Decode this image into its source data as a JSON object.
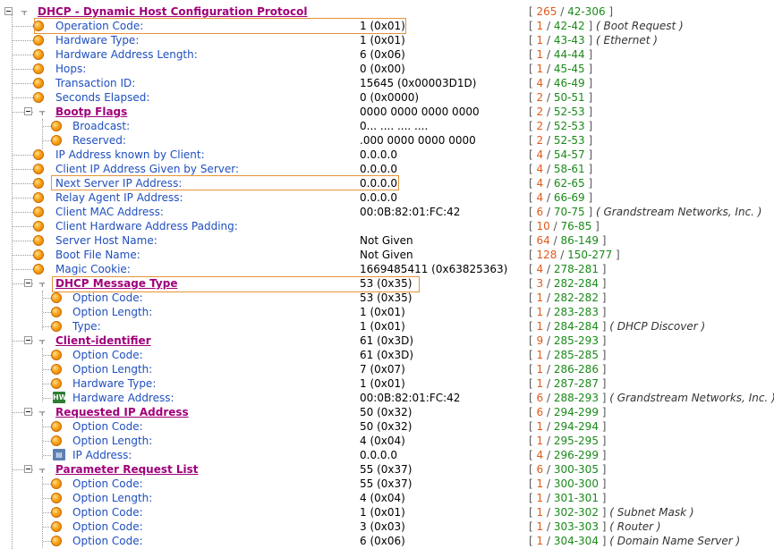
{
  "header": {
    "label": "DHCP - Dynamic Host Configuration Protocol",
    "range_len": "265",
    "range_off": "42-306"
  },
  "rows": [
    {
      "label": "Operation Code:",
      "value": "1 (0x01)",
      "len": "1",
      "off": "42-42",
      "desc": "Boot Request"
    },
    {
      "label": "Hardware Type:",
      "value": "1 (0x01)",
      "len": "1",
      "off": "43-43",
      "desc": "Ethernet"
    },
    {
      "label": "Hardware Address Length:",
      "value": "6 (0x06)",
      "len": "1",
      "off": "44-44",
      "desc": ""
    },
    {
      "label": "Hops:",
      "value": "0 (0x00)",
      "len": "1",
      "off": "45-45",
      "desc": ""
    },
    {
      "label": "Transaction ID:",
      "value": "15645 (0x00003D1D)",
      "len": "4",
      "off": "46-49",
      "desc": ""
    },
    {
      "label": "Seconds Elapsed:",
      "value": "0 (0x0000)",
      "len": "2",
      "off": "50-51",
      "desc": ""
    },
    {
      "label": "Bootp Flags",
      "value": "0000 0000 0000 0000",
      "len": "2",
      "off": "52-53",
      "desc": ""
    },
    {
      "label": "Broadcast:",
      "value": "0... .... .... ....",
      "len": "2",
      "off": "52-53",
      "desc": ""
    },
    {
      "label": "Reserved:",
      "value": ".000 0000 0000 0000",
      "len": "2",
      "off": "52-53",
      "desc": ""
    },
    {
      "label": "IP Address known by Client:",
      "value": "0.0.0.0",
      "len": "4",
      "off": "54-57",
      "desc": ""
    },
    {
      "label": "Client IP Address Given by Server:",
      "value": "0.0.0.0",
      "len": "4",
      "off": "58-61",
      "desc": ""
    },
    {
      "label": "Next Server IP Address:",
      "value": "0.0.0.0",
      "len": "4",
      "off": "62-65",
      "desc": ""
    },
    {
      "label": "Relay Agent IP Address:",
      "value": "0.0.0.0",
      "len": "4",
      "off": "66-69",
      "desc": ""
    },
    {
      "label": "Client MAC Address:",
      "value": "00:0B:82:01:FC:42",
      "len": "6",
      "off": "70-75",
      "desc": "Grandstream Networks, Inc."
    },
    {
      "label": "Client Hardware Address Padding:",
      "value": "",
      "len": "10",
      "off": "76-85",
      "desc": ""
    },
    {
      "label": "Server Host Name:",
      "value": "Not Given",
      "len": "64",
      "off": "86-149",
      "desc": ""
    },
    {
      "label": "Boot File Name:",
      "value": "Not Given",
      "len": "128",
      "off": "150-277",
      "desc": ""
    },
    {
      "label": "Magic Cookie:",
      "value": "1669485411 (0x63825363)",
      "len": "4",
      "off": "278-281",
      "desc": ""
    },
    {
      "label": "DHCP Message Type",
      "value": "53 (0x35)",
      "len": "3",
      "off": "282-284",
      "desc": ""
    },
    {
      "label": "Option Code:",
      "value": "53 (0x35)",
      "len": "1",
      "off": "282-282",
      "desc": ""
    },
    {
      "label": "Option Length:",
      "value": "1 (0x01)",
      "len": "1",
      "off": "283-283",
      "desc": ""
    },
    {
      "label": "Type:",
      "value": "1 (0x01)",
      "len": "1",
      "off": "284-284",
      "desc": "DHCP Discover"
    },
    {
      "label": "Client-identifier",
      "value": "61 (0x3D)",
      "len": "9",
      "off": "285-293",
      "desc": ""
    },
    {
      "label": "Option Code:",
      "value": "61 (0x3D)",
      "len": "1",
      "off": "285-285",
      "desc": ""
    },
    {
      "label": "Option Length:",
      "value": "7 (0x07)",
      "len": "1",
      "off": "286-286",
      "desc": ""
    },
    {
      "label": "Hardware Type:",
      "value": "1 (0x01)",
      "len": "1",
      "off": "287-287",
      "desc": ""
    },
    {
      "label": "Hardware Address:",
      "value": "00:0B:82:01:FC:42",
      "len": "6",
      "off": "288-293",
      "desc": "Grandstream Networks, Inc."
    },
    {
      "label": "Requested IP Address",
      "value": "50 (0x32)",
      "len": "6",
      "off": "294-299",
      "desc": ""
    },
    {
      "label": "Option Code:",
      "value": "50 (0x32)",
      "len": "1",
      "off": "294-294",
      "desc": ""
    },
    {
      "label": "Option Length:",
      "value": "4 (0x04)",
      "len": "1",
      "off": "295-295",
      "desc": ""
    },
    {
      "label": "IP Address:",
      "value": "0.0.0.0",
      "len": "4",
      "off": "296-299",
      "desc": ""
    },
    {
      "label": "Parameter Request List",
      "value": "55 (0x37)",
      "len": "6",
      "off": "300-305",
      "desc": ""
    },
    {
      "label": "Option Code:",
      "value": "55 (0x37)",
      "len": "1",
      "off": "300-300",
      "desc": ""
    },
    {
      "label": "Option Length:",
      "value": "4 (0x04)",
      "len": "1",
      "off": "301-301",
      "desc": ""
    },
    {
      "label": "Option Code:",
      "value": "1 (0x01)",
      "len": "1",
      "off": "302-302",
      "desc": "Subnet Mask"
    },
    {
      "label": "Option Code:",
      "value": "3 (0x03)",
      "len": "1",
      "off": "303-303",
      "desc": "Router"
    },
    {
      "label": "Option Code:",
      "value": "6 (0x06)",
      "len": "1",
      "off": "304-304",
      "desc": "Domain Name Server"
    }
  ]
}
